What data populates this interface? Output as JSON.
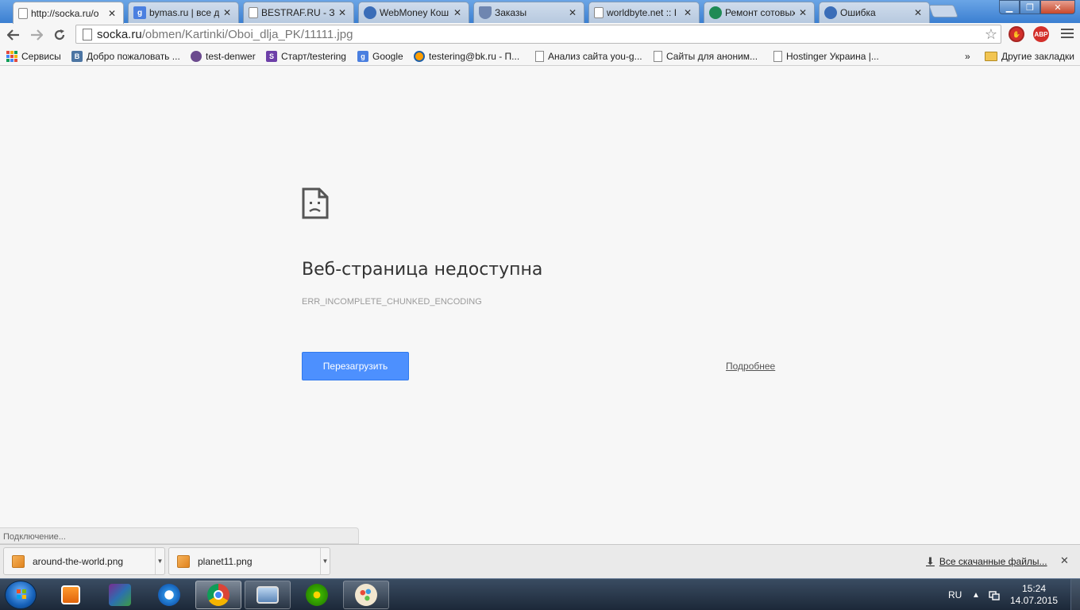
{
  "tabs": [
    {
      "title": "http://socka.ru/o",
      "favicon": "page-icon",
      "active": true
    },
    {
      "title": "bymas.ru | все д",
      "favicon": "google-icon",
      "active": false
    },
    {
      "title": "BESTRAF.RU - За",
      "favicon": "page-icon",
      "active": false
    },
    {
      "title": "WebMoney Кош",
      "favicon": "globe-icon",
      "active": false
    },
    {
      "title": "Заказы",
      "favicon": "shield-icon",
      "active": false
    },
    {
      "title": "worldbyte.net :: I",
      "favicon": "page-icon",
      "active": false
    },
    {
      "title": "Ремонт сотовых",
      "favicon": "green-icon",
      "active": false
    },
    {
      "title": "Ошибка",
      "favicon": "globe-icon",
      "active": false
    }
  ],
  "tab_close_glyph": "✕",
  "address": {
    "host": "socka.ru",
    "path": "/obmen/Kartinki/Oboi_dlja_PK/11111.jpg"
  },
  "bookmarks": [
    {
      "label": "Сервисы",
      "icon": "apps-grid-icon"
    },
    {
      "label": "Добро пожаловать ...",
      "icon": "vk-icon"
    },
    {
      "label": "test-denwer",
      "icon": "denwer-icon"
    },
    {
      "label": "Старт/testering",
      "icon": "s-icon"
    },
    {
      "label": "Google",
      "icon": "google-icon"
    },
    {
      "label": "testering@bk.ru - П...",
      "icon": "mail-icon"
    },
    {
      "label": "Анализ сайта you-g...",
      "icon": "page-icon"
    },
    {
      "label": "Сайты для аноним...",
      "icon": "page-icon"
    },
    {
      "label": "Hostinger Украина |...",
      "icon": "page-icon"
    }
  ],
  "bookmarks_overflow": "»",
  "other_bookmarks": "Другие закладки",
  "error": {
    "title": "Веб-страница недоступна",
    "code": "ERR_INCOMPLETE_CHUNKED_ENCODING",
    "reload_label": "Перезагрузить",
    "details_label": "Подробнее"
  },
  "status_text": "Подключение...",
  "downloads": [
    {
      "name": "around-the-world.png"
    },
    {
      "name": "planet11.png"
    }
  ],
  "all_downloads_label": "Все скачанные файлы...",
  "taskbar": {
    "lang": "RU",
    "time": "15:24",
    "date": "14.07.2015"
  },
  "colors": {
    "accent_button": "#4d90fe",
    "page_background": "#f7f7f7"
  }
}
